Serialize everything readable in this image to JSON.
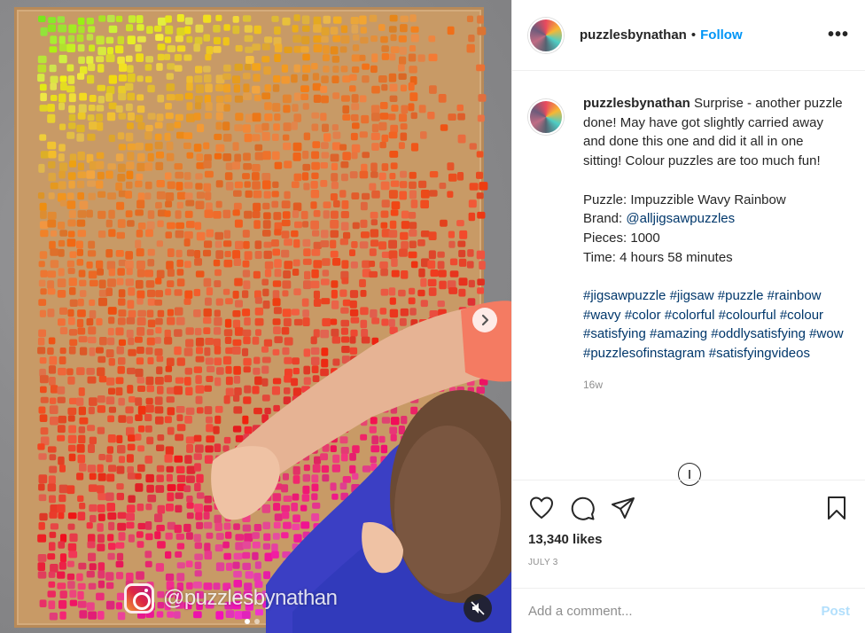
{
  "header": {
    "username": "puzzlesbynathan",
    "separator": "•",
    "follow_label": "Follow",
    "more_icon": "more-horizontal-icon"
  },
  "media": {
    "watermark": "@puzzlesbynathan",
    "next_icon": "chevron-right-icon",
    "mute_icon": "muted-speaker-icon",
    "carousel": {
      "total": 2,
      "active_index": 0
    }
  },
  "caption": {
    "username": "puzzlesbynathan",
    "text": "Surprise - another puzzle done! May have got slightly carried away and done this one and did it all in one sitting! Colour puzzles are too much fun!",
    "details": {
      "puzzle": "Puzzle: Impuzzible Wavy Rainbow",
      "brand_prefix": "Brand: ",
      "brand_link": "@alljigsawpuzzles",
      "pieces": "Pieces: 1000",
      "time": "Time: 4 hours 58 minutes"
    },
    "hashtags": [
      "#jigsawpuzzle",
      "#jigsaw",
      "#puzzle",
      "#rainbow",
      "#wavy",
      "#color",
      "#colorful",
      "#colourful",
      "#colour",
      "#satisfying",
      "#amazing",
      "#oddlysatisfying",
      "#wow",
      "#puzzlesofinstagram",
      "#satisfyingvideos"
    ],
    "time_ago": "16w"
  },
  "actions": {
    "like_icon": "heart-icon",
    "comment_icon": "comment-icon",
    "share_icon": "send-icon",
    "save_icon": "bookmark-icon",
    "likes": "13,340 likes",
    "date": "JULY 3"
  },
  "comment": {
    "placeholder": "Add a comment...",
    "post_label": "Post"
  },
  "colors": {
    "link_blue": "#0095f6",
    "post_disabled": "#b2dffc",
    "muted_text": "#8e8e8e"
  }
}
